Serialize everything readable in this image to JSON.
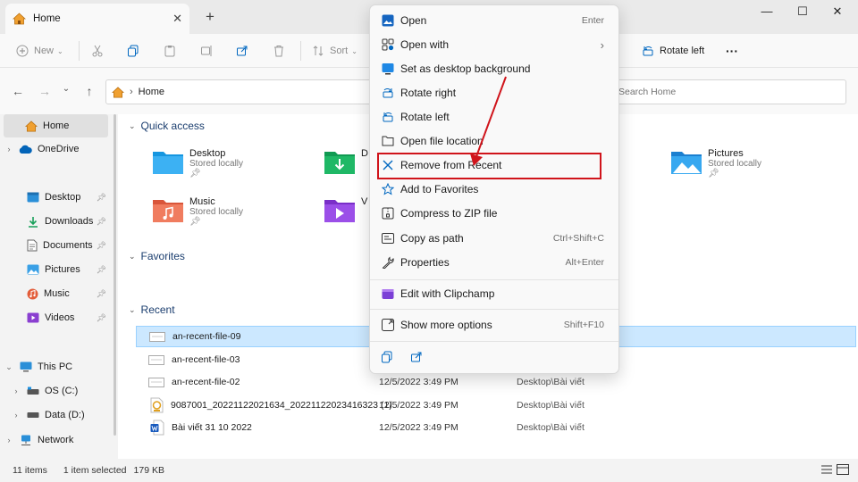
{
  "window": {
    "tab_title": "Home",
    "tab_close": "✕",
    "new_tab": "+",
    "minimize": "—",
    "maximize": "☐",
    "close": "✕"
  },
  "toolbar": {
    "new_label": "New",
    "sort_label": "Sort",
    "rotate_left_label": "Rotate left",
    "more_label": "···"
  },
  "address": {
    "location": "Home",
    "search_placeholder": "Search Home"
  },
  "sidebar": {
    "items": [
      {
        "label": "Home"
      },
      {
        "label": "OneDrive"
      },
      {
        "label": "Desktop"
      },
      {
        "label": "Downloads"
      },
      {
        "label": "Documents"
      },
      {
        "label": "Pictures"
      },
      {
        "label": "Music"
      },
      {
        "label": "Videos"
      },
      {
        "label": "This PC"
      },
      {
        "label": "OS (C:)"
      },
      {
        "label": "Data (D:)"
      },
      {
        "label": "Network"
      }
    ]
  },
  "content": {
    "quick_access_title": "Quick access",
    "favorites_title": "Favorites",
    "recent_title": "Recent",
    "quick_access": [
      {
        "name": "Desktop",
        "sub": "Stored locally"
      },
      {
        "name": "D",
        "sub": ""
      },
      {
        "name": "Pictures",
        "sub": "Stored locally"
      },
      {
        "name": "Music",
        "sub": "Stored locally"
      },
      {
        "name": "V",
        "sub": ""
      }
    ],
    "recent": [
      {
        "name": "an-recent-file-09",
        "date": "",
        "loc": ""
      },
      {
        "name": "an-recent-file-03",
        "date": "",
        "loc": ""
      },
      {
        "name": "an-recent-file-02",
        "date": "12/5/2022 3:49 PM",
        "loc": "Desktop\\Bài viết"
      },
      {
        "name": "9087001_20221122021634_20221122023416323 (1)",
        "date": "12/5/2022 3:49 PM",
        "loc": "Desktop\\Bài viết"
      },
      {
        "name": "Bài viết 31 10 2022",
        "date": "12/5/2022 3:49 PM",
        "loc": "Desktop\\Bài viết"
      }
    ]
  },
  "context_menu": {
    "items": [
      {
        "label": "Open",
        "shortcut": "Enter"
      },
      {
        "label": "Open with",
        "shortcut": "›"
      },
      {
        "label": "Set as desktop background",
        "shortcut": ""
      },
      {
        "label": "Rotate right",
        "shortcut": ""
      },
      {
        "label": "Rotate left",
        "shortcut": ""
      },
      {
        "label": "Open file location",
        "shortcut": ""
      },
      {
        "label": "Remove from Recent",
        "shortcut": ""
      },
      {
        "label": "Add to Favorites",
        "shortcut": ""
      },
      {
        "label": "Compress to ZIP file",
        "shortcut": ""
      },
      {
        "label": "Copy as path",
        "shortcut": "Ctrl+Shift+C"
      },
      {
        "label": "Properties",
        "shortcut": "Alt+Enter"
      },
      {
        "label": "Edit with Clipchamp",
        "shortcut": ""
      },
      {
        "label": "Show more options",
        "shortcut": "Shift+F10"
      }
    ]
  },
  "status": {
    "count": "11 items",
    "selection": "1 item selected",
    "size": "179 KB"
  },
  "colors": {
    "accent": "#0067c0",
    "folder_blue": "#1e9be8",
    "highlight_red": "#d0141b",
    "selection": "#cce8ff"
  }
}
